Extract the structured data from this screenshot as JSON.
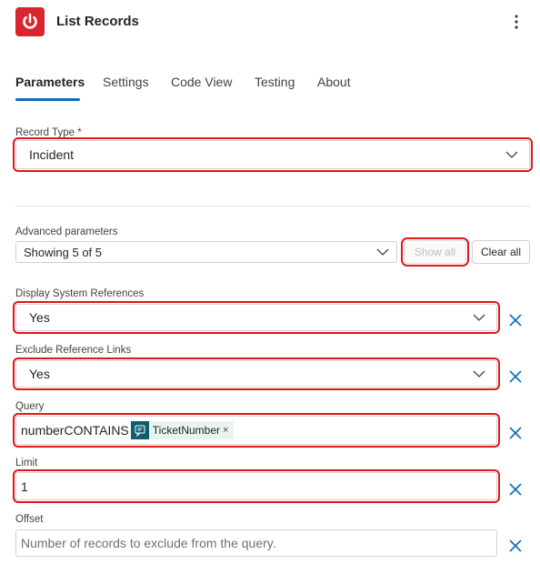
{
  "header": {
    "title": "List Records",
    "app_icon": "power-icon",
    "more_icon": "more-vertical-icon"
  },
  "tabs": [
    {
      "label": "Parameters",
      "active": true
    },
    {
      "label": "Settings",
      "active": false
    },
    {
      "label": "Code View",
      "active": false
    },
    {
      "label": "Testing",
      "active": false
    },
    {
      "label": "About",
      "active": false
    }
  ],
  "record_type": {
    "label": "Record Type",
    "required_mark": "*",
    "value": "Incident"
  },
  "advanced": {
    "label": "Advanced parameters",
    "value": "Showing 5 of 5",
    "show_all_label": "Show all",
    "clear_all_label": "Clear all"
  },
  "display_system_references": {
    "label": "Display System References",
    "value": "Yes"
  },
  "exclude_reference_links": {
    "label": "Exclude Reference Links",
    "value": "Yes"
  },
  "query": {
    "label": "Query",
    "text": "numberCONTAINS",
    "token_label": "TicketNumber",
    "token_remove": "×"
  },
  "limit": {
    "label": "Limit",
    "value": "1"
  },
  "offset": {
    "label": "Offset",
    "placeholder": "Number of records to exclude from the query."
  },
  "colors": {
    "accent": "#0f6cbd",
    "highlight": "#e0161b",
    "app_icon_bg": "#d9262e",
    "token_bg": "#e8f4ef"
  }
}
